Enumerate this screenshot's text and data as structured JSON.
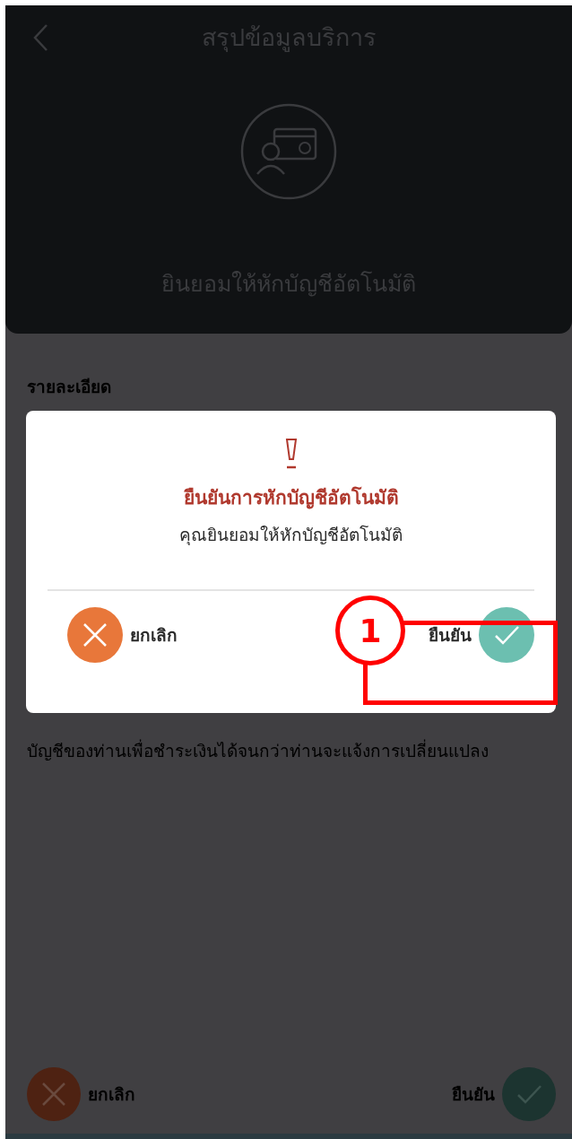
{
  "header": {
    "title": "สรุปข้อมูลบริการ",
    "service_name": "ยินยอมให้หักบัญชีอัตโนมัติ"
  },
  "details": {
    "heading": "รายละเอียด",
    "text": "บัญชีของท่านเพื่อชำระเงินได้จนกว่าท่านจะแจ้งการเปลี่ยนแปลง"
  },
  "bottom_actions": {
    "cancel": "ยกเลิก",
    "confirm": "ยืนยัน"
  },
  "dialog": {
    "title": "ยืนยันการหักบัญชีอัตโนมัติ",
    "message": "คุณยินยอมให้หักบัญชีอัตโนมัติ",
    "cancel": "ยกเลิก",
    "confirm": "ยืนยัน"
  },
  "annotation": {
    "number": "1"
  }
}
